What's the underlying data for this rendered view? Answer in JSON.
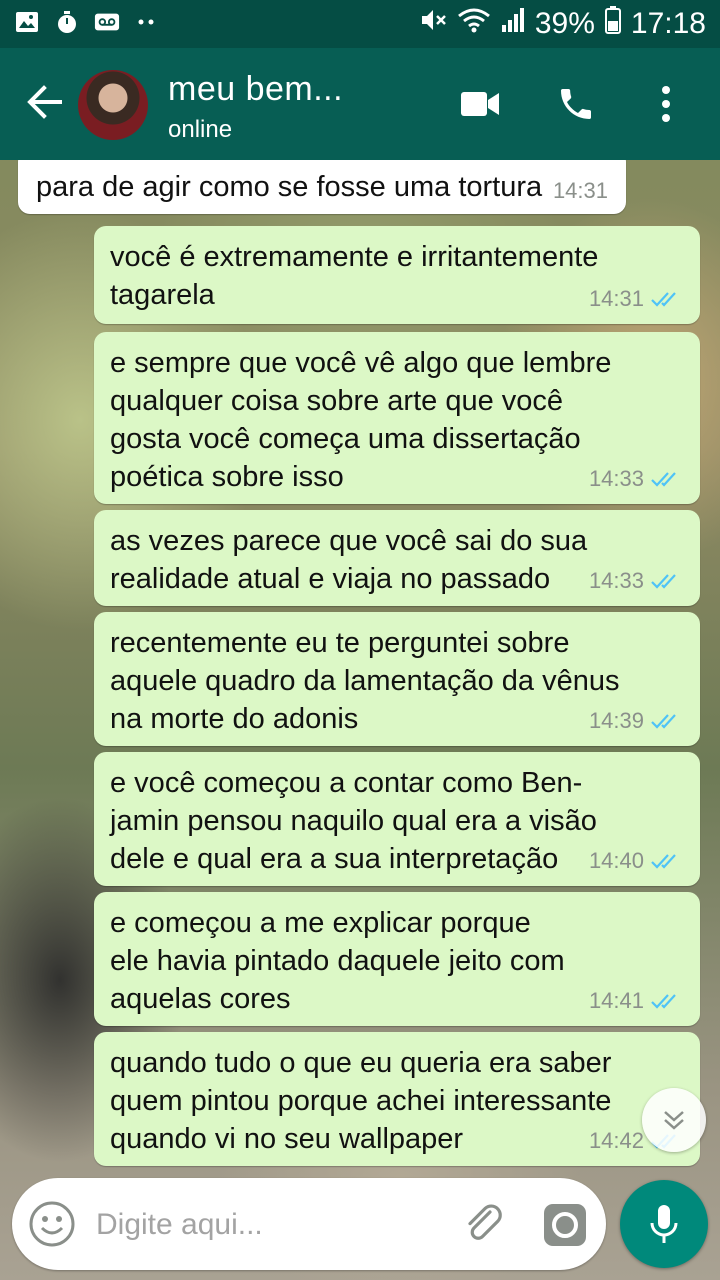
{
  "status_bar": {
    "battery": "39%",
    "time": "17:18",
    "icons": [
      "gallery-icon",
      "stopwatch-icon",
      "voicemail-icon",
      "dots-icon",
      "mute-icon",
      "wifi-icon",
      "signal-icon",
      "battery-icon"
    ]
  },
  "header": {
    "contact_name": "meu bem...",
    "contact_status": "online",
    "icons": [
      "back-arrow-icon",
      "video-call-icon",
      "phone-icon",
      "more-vert-icon"
    ]
  },
  "messages": [
    {
      "type": "incoming",
      "text": "para de agir como se fosse uma tortura",
      "time": "14:31"
    },
    {
      "type": "outgoing",
      "text": "você é extremamente e irritantemente\ntagarela",
      "time": "14:31",
      "read": true
    },
    {
      "type": "outgoing",
      "text": "e sempre que você vê algo que lembre\nqualquer coisa sobre arte que você\ngosta você começa uma dissertação\npoética sobre isso",
      "time": "14:33",
      "read": true
    },
    {
      "type": "outgoing",
      "text": "as vezes parece que você sai do sua\nrealidade atual e viaja no passado",
      "time": "14:33",
      "read": true
    },
    {
      "type": "outgoing",
      "text": "recentemente eu te perguntei sobre\naquele quadro da lamentação da vênus\nna morte do adonis",
      "time": "14:39",
      "read": true
    },
    {
      "type": "outgoing",
      "text": "e você começou a contar como Ben-\njamin pensou naquilo qual era a visão\ndele e qual era a sua interpretação",
      "time": "14:40",
      "read": true
    },
    {
      "type": "outgoing",
      "text": "e começou a me explicar porque\nele havia pintado daquele jeito com\naquelas cores",
      "time": "14:41",
      "read": true
    },
    {
      "type": "outgoing",
      "text": "quando tudo o que eu queria era saber\nquem pintou porque achei interessante\nquando vi no seu wallpaper",
      "time": "14:42",
      "read": true
    }
  ],
  "composer": {
    "placeholder": "Digite aqui...",
    "value": ""
  },
  "colors": {
    "status_bar": "#054d44",
    "app_bar": "#075e54",
    "outgoing_bubble": "#dcf8c6",
    "incoming_bubble": "#ffffff",
    "read_ticks": "#4fc3f7",
    "mic_button": "#00897b"
  }
}
